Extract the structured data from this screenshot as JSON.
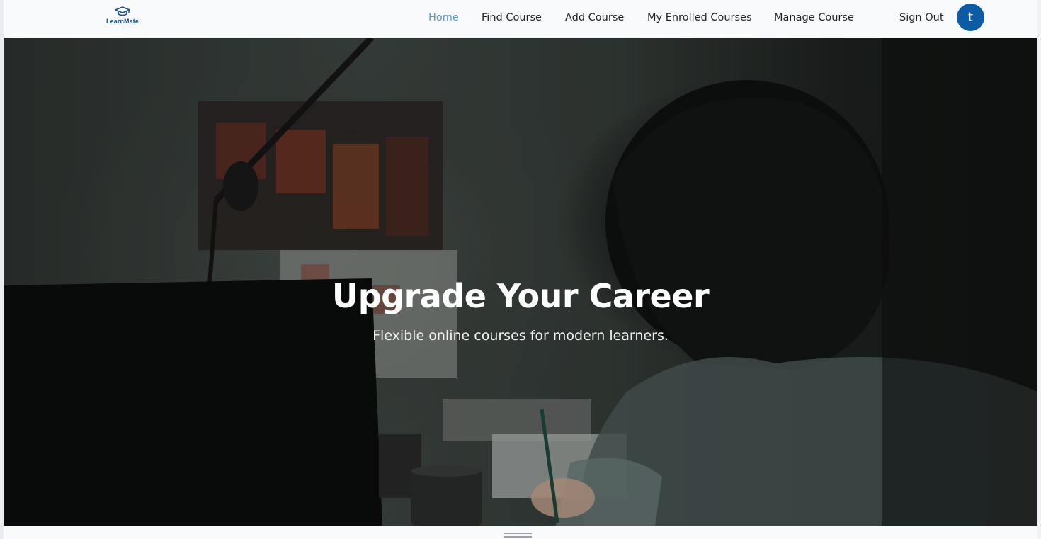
{
  "brand": {
    "name": "LearnMate",
    "logo_icon": "graduation-cap-icon",
    "color": "#1e4f8c"
  },
  "nav": {
    "items": [
      {
        "label": "Home",
        "active": true
      },
      {
        "label": "Find Course",
        "active": false
      },
      {
        "label": "Add Course",
        "active": false
      },
      {
        "label": "My Enrolled Courses",
        "active": false
      },
      {
        "label": "Manage Course",
        "active": false
      }
    ],
    "sign_out": "Sign Out",
    "avatar_initial": "t",
    "active_color": "#5b95d6",
    "avatar_color": "#0b5ca5"
  },
  "hero": {
    "title": "Upgrade Your Career",
    "subtitle": "Flexible online courses for modern learners."
  }
}
